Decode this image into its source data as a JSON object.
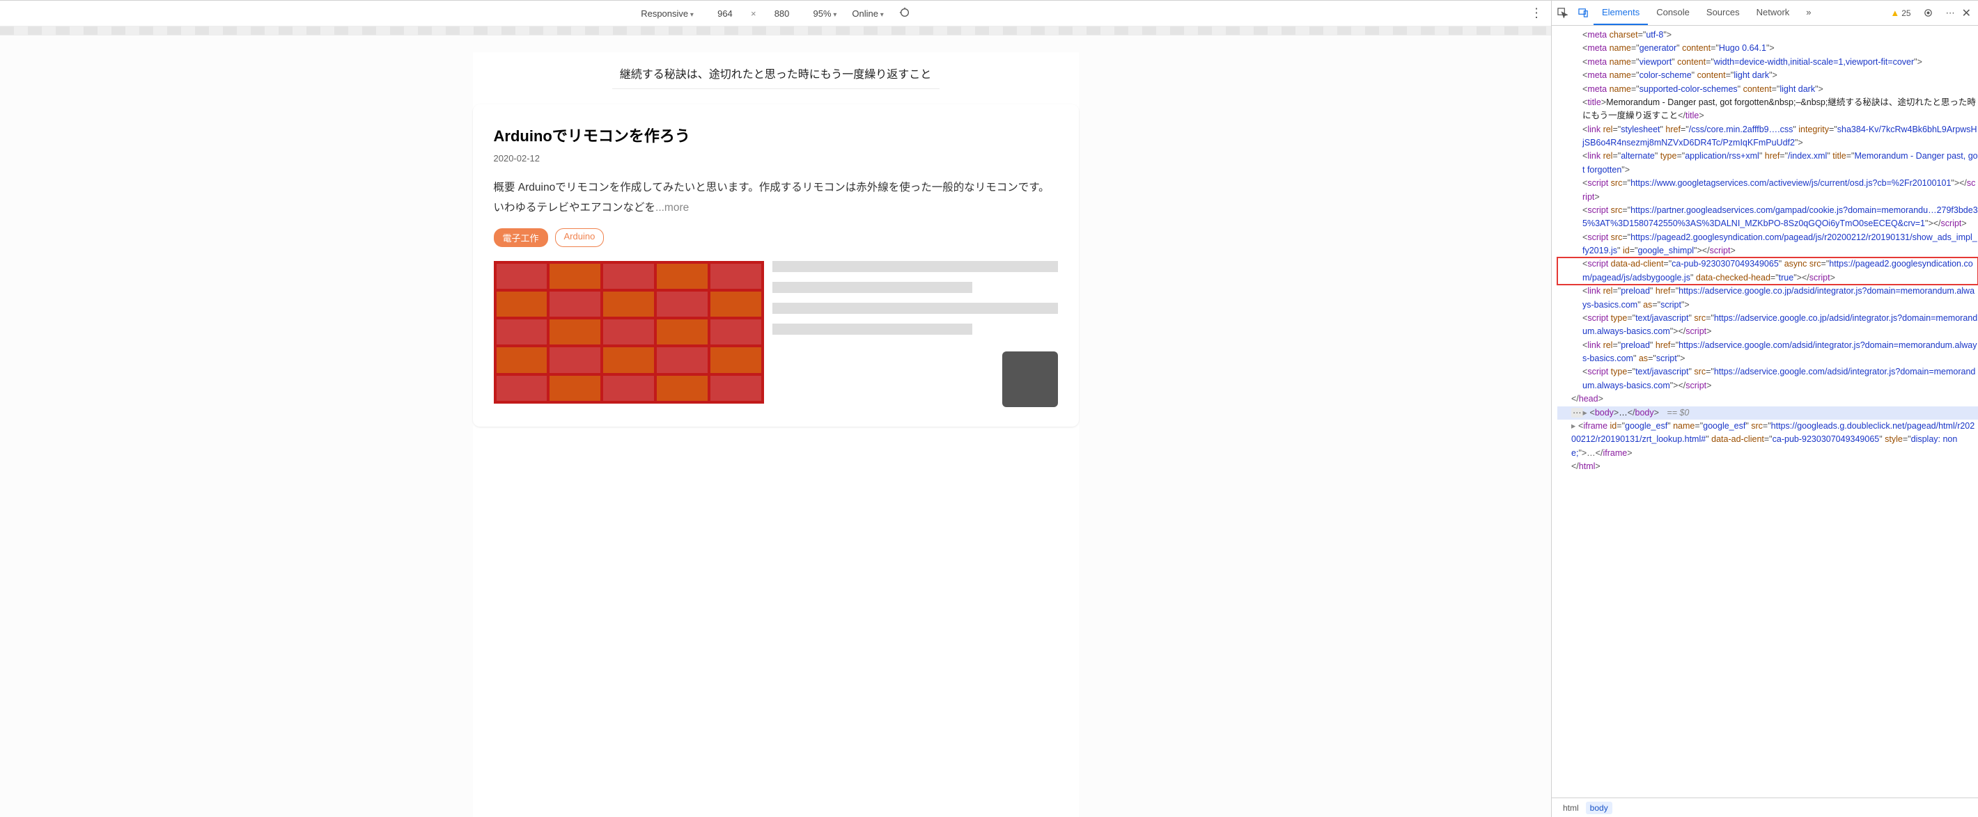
{
  "deviceToolbar": {
    "mode": "Responsive",
    "width": "964",
    "height": "880",
    "zoom": "95%",
    "throttling": "Online"
  },
  "page": {
    "subtitle": "継続する秘訣は、途切れたと思った時にもう一度繰り返すこと",
    "article": {
      "title": "Arduinoでリモコンを作ろう",
      "date": "2020-02-12",
      "excerpt": "概要 Arduinoでリモコンを作成してみたいと思います。作成するリモコンは赤外線を使った一般的なリモコンです。いわゆるテレビやエアコンなどを",
      "more": "...more",
      "tags": [
        "電子工作",
        "Arduino"
      ]
    }
  },
  "devtools": {
    "tabs": [
      "Elements",
      "Console",
      "Sources",
      "Network"
    ],
    "activeTab": "Elements",
    "warnings": "25",
    "crumbs": [
      "html",
      "body"
    ]
  },
  "dom": {
    "lines": [
      {
        "html": "<span class='pun'>&lt;</span><span class='tname'>meta</span> <span class='attr'>charset</span><span class='pun'>=\"</span><span class='val'>utf-8</span><span class='pun'>\"&gt;</span>"
      },
      {
        "html": "<span class='pun'>&lt;</span><span class='tname'>meta</span> <span class='attr'>name</span><span class='pun'>=\"</span><span class='val'>generator</span><span class='pun'>\"</span> <span class='attr'>content</span><span class='pun'>=\"</span><span class='val'>Hugo 0.64.1</span><span class='pun'>\"&gt;</span>"
      },
      {
        "html": "<span class='pun'>&lt;</span><span class='tname'>meta</span> <span class='attr'>name</span><span class='pun'>=\"</span><span class='val'>viewport</span><span class='pun'>\"</span> <span class='attr'>content</span><span class='pun'>=\"</span><span class='val'>width=device-width,initial-scale=1,viewport-fit=cover</span><span class='pun'>\"&gt;</span>"
      },
      {
        "html": "<span class='pun'>&lt;</span><span class='tname'>meta</span> <span class='attr'>name</span><span class='pun'>=\"</span><span class='val'>color-scheme</span><span class='pun'>\"</span> <span class='attr'>content</span><span class='pun'>=\"</span><span class='val'>light dark</span><span class='pun'>\"&gt;</span>"
      },
      {
        "html": "<span class='pun'>&lt;</span><span class='tname'>meta</span> <span class='attr'>name</span><span class='pun'>=\"</span><span class='val'>supported-color-schemes</span><span class='pun'>\"</span> <span class='attr'>content</span><span class='pun'>=\"</span><span class='val'>light dark</span><span class='pun'>\"&gt;</span>"
      },
      {
        "html": "<span class='pun'>&lt;</span><span class='tname'>title</span><span class='pun'>&gt;</span><span class='txt'>Memorandum - Danger past, got forgotten&amp;nbsp;–&amp;nbsp;継続する秘訣は、途切れたと思った時にもう一度繰り返すこと</span><span class='pun'>&lt;/</span><span class='tname'>title</span><span class='pun'>&gt;</span>"
      },
      {
        "html": "<span class='pun'>&lt;</span><span class='tname'>link</span> <span class='attr'>rel</span><span class='pun'>=\"</span><span class='val'>stylesheet</span><span class='pun'>\"</span> <span class='attr'>href</span><span class='pun'>=\"</span><span class='val'>/css/core.min.2afffb9….css</span><span class='pun'>\"</span> <span class='attr'>integrity</span><span class='pun'>=\"</span><span class='val'>sha384-Kv/7kcRw4Bk6bhL9ArpwsHjSB6o4R4nsezmj8mNZVxD6DR4Tc/PzmIqKFmPuUdf2</span><span class='pun'>\"&gt;</span>"
      },
      {
        "html": "<span class='pun'>&lt;</span><span class='tname'>link</span> <span class='attr'>rel</span><span class='pun'>=\"</span><span class='val'>alternate</span><span class='pun'>\"</span> <span class='attr'>type</span><span class='pun'>=\"</span><span class='val'>application/rss+xml</span><span class='pun'>\"</span> <span class='attr'>href</span><span class='pun'>=\"</span><span class='val'>/index.xml</span><span class='pun'>\"</span> <span class='attr'>title</span><span class='pun'>=\"</span><span class='val'>Memorandum - Danger past, got forgotten</span><span class='pun'>\"&gt;</span>"
      },
      {
        "html": "<span class='pun'>&lt;</span><span class='tname'>script</span> <span class='attr'>src</span><span class='pun'>=\"</span><span class='val'>https://www.googletagservices.com/activeview/js/current/osd.js?cb=%2Fr20100101</span><span class='pun'>\"&gt;&lt;/</span><span class='tname'>script</span><span class='pun'>&gt;</span>"
      },
      {
        "html": "<span class='pun'>&lt;</span><span class='tname'>script</span> <span class='attr'>src</span><span class='pun'>=\"</span><span class='val'>https://partner.googleadservices.com/gampad/cookie.js?domain=memorandu…279f3bde35%3AT%3D1580742550%3AS%3DALNI_MZKbPO-8Sz0qGQOi6yTmO0seECEQ&amp;crv=1</span><span class='pun'>\"&gt;&lt;/</span><span class='tname'>script</span><span class='pun'>&gt;</span>"
      },
      {
        "html": "<span class='pun'>&lt;</span><span class='tname'>script</span> <span class='attr'>src</span><span class='pun'>=\"</span><span class='val'>https://pagead2.googlesyndication.com/pagead/js/r20200212/r20190131/show_ads_impl_fy2019.js</span><span class='pun'>\"</span> <span class='attr'>id</span><span class='pun'>=\"</span><span class='val'>google_shimpl</span><span class='pun'>\"&gt;&lt;/</span><span class='tname'>script</span><span class='pun'>&gt;</span>"
      },
      {
        "highlight": true,
        "html": "<span class='pun'>&lt;</span><span class='tname'>script</span> <span class='attr'>data-ad-client</span><span class='pun'>=\"</span><span class='val'>ca-pub-9230307049349065</span><span class='pun'>\"</span> <span class='attr'>async</span> <span class='attr'>src</span><span class='pun'>=\"</span><span class='val'>https://pagead2.googlesyndication.com/pagead/js/adsbygoogle.js</span><span class='pun'>\"</span> <span class='attr'>data-checked-head</span><span class='pun'>=\"</span><span class='val'>true</span><span class='pun'>\"&gt;&lt;/</span><span class='tname'>script</span><span class='pun'>&gt;</span>"
      },
      {
        "html": "<span class='pun'>&lt;</span><span class='tname'>link</span> <span class='attr'>rel</span><span class='pun'>=\"</span><span class='val'>preload</span><span class='pun'>\"</span> <span class='attr'>href</span><span class='pun'>=\"</span><span class='val'>https://adservice.google.co.jp/adsid/integrator.js?domain=memorandum.always-basics.com</span><span class='pun'>\"</span> <span class='attr'>as</span><span class='pun'>=\"</span><span class='val'>script</span><span class='pun'>\"&gt;</span>"
      },
      {
        "html": "<span class='pun'>&lt;</span><span class='tname'>script</span> <span class='attr'>type</span><span class='pun'>=\"</span><span class='val'>text/javascript</span><span class='pun'>\"</span> <span class='attr'>src</span><span class='pun'>=\"</span><span class='val'>https://adservice.google.co.jp/adsid/integrator.js?domain=memorandum.always-basics.com</span><span class='pun'>\"&gt;&lt;/</span><span class='tname'>script</span><span class='pun'>&gt;</span>"
      },
      {
        "html": "<span class='pun'>&lt;</span><span class='tname'>link</span> <span class='attr'>rel</span><span class='pun'>=\"</span><span class='val'>preload</span><span class='pun'>\"</span> <span class='attr'>href</span><span class='pun'>=\"</span><span class='val'>https://adservice.google.com/adsid/integrator.js?domain=memorandum.always-basics.com</span><span class='pun'>\"</span> <span class='attr'>as</span><span class='pun'>=\"</span><span class='val'>script</span><span class='pun'>\"&gt;</span>"
      },
      {
        "html": "<span class='pun'>&lt;</span><span class='tname'>script</span> <span class='attr'>type</span><span class='pun'>=\"</span><span class='val'>text/javascript</span><span class='pun'>\"</span> <span class='attr'>src</span><span class='pun'>=\"</span><span class='val'>https://adservice.google.com/adsid/integrator.js?domain=memorandum.always-basics.com</span><span class='pun'>\"&gt;&lt;/</span><span class='tname'>script</span><span class='pun'>&gt;</span>"
      },
      {
        "indent": "ind1",
        "html": "<span class='pun'>&lt;/</span><span class='tname'>head</span><span class='pun'>&gt;</span>"
      },
      {
        "indent": "ind1",
        "selected": true,
        "html": "<span class='ellips'>⋯</span><span class='caret'>▸</span><span class='pun'>&lt;</span><span class='tname'>body</span><span class='pun'>&gt;</span><span class='txt'>…</span><span class='pun'>&lt;/</span><span class='tname'>body</span><span class='pun'>&gt;</span><span class='dollar'> == $0</span>"
      },
      {
        "indent": "ind1",
        "html": "<span class='caret'>▸</span><span class='pun'>&lt;</span><span class='tname'>iframe</span> <span class='attr'>id</span><span class='pun'>=\"</span><span class='val'>google_esf</span><span class='pun'>\"</span> <span class='attr'>name</span><span class='pun'>=\"</span><span class='val'>google_esf</span><span class='pun'>\"</span> <span class='attr'>src</span><span class='pun'>=\"</span><span class='val'>https://googleads.g.doubleclick.net/pagead/html/r20200212/r20190131/zrt_lookup.html#</span><span class='pun'>\"</span> <span class='attr'>data-ad-client</span><span class='pun'>=\"</span><span class='val'>ca-pub-9230307049349065</span><span class='pun'>\"</span> <span class='attr'>style</span><span class='pun'>=\"</span><span class='val'>display: none;</span><span class='pun'>\"&gt;…&lt;/</span><span class='tname'>iframe</span><span class='pun'>&gt;</span>"
      },
      {
        "indent": "ind1",
        "html": "<span class='pun'>&lt;/</span><span class='tname'>html</span><span class='pun'>&gt;</span>"
      }
    ]
  }
}
